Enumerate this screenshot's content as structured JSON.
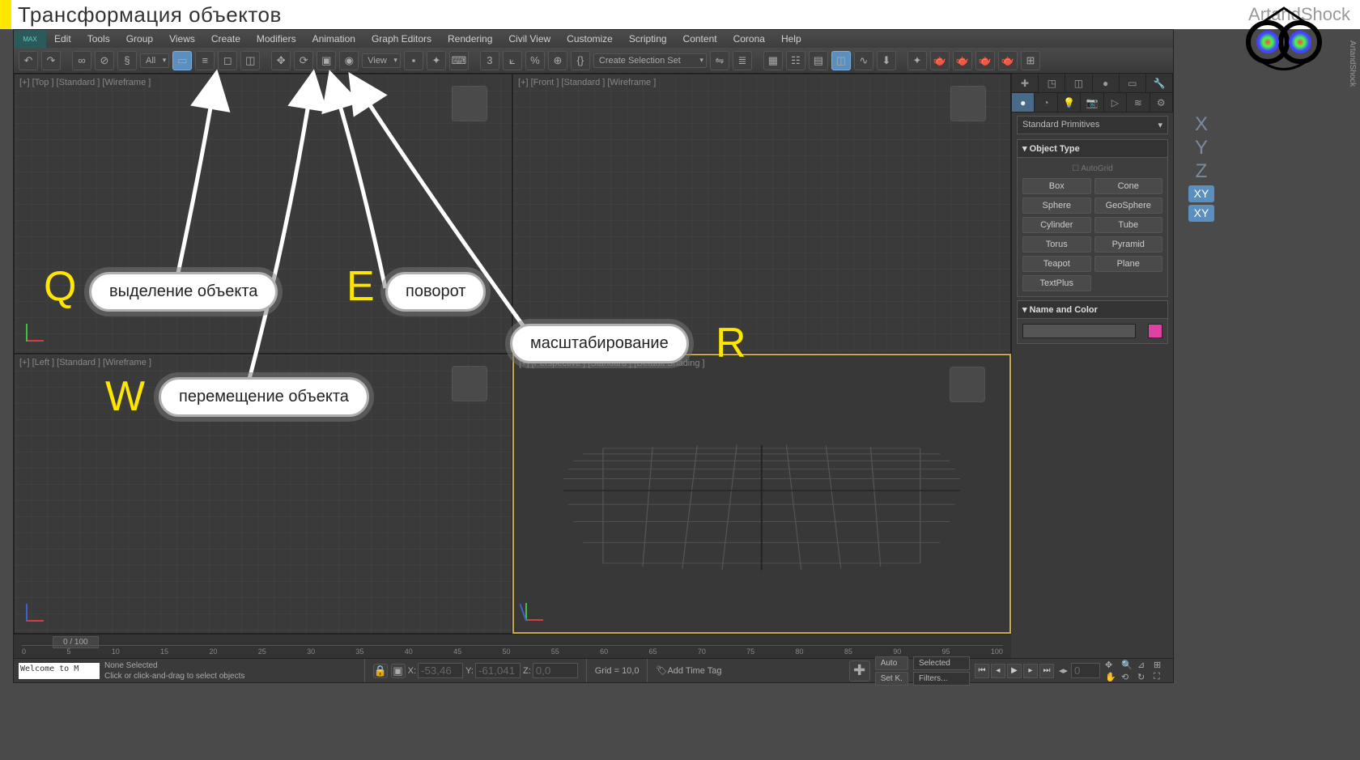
{
  "page_title": "Трансформация объектов",
  "brand": "ArtandShock",
  "menus": [
    "Edit",
    "Tools",
    "Group",
    "Views",
    "Create",
    "Modifiers",
    "Animation",
    "Graph Editors",
    "Rendering",
    "Civil View",
    "Customize",
    "Scripting",
    "Content",
    "Corona",
    "Help"
  ],
  "toolbar": {
    "filter_dd": "All",
    "ref_dd": "View",
    "selection_set_dd": "Create Selection Set"
  },
  "viewports": {
    "top": "[+] [Top ] [Standard ] [Wireframe ]",
    "front": "[+] [Front ] [Standard ] [Wireframe ]",
    "left": "[+] [Left ] [Standard ] [Wireframe ]",
    "persp": "[+] [Perspective ] [Standard ] [Default Shading ]"
  },
  "command_panel": {
    "dropdown": "Standard Primitives",
    "object_type_header": "Object Type",
    "autogrid": "AutoGrid",
    "primitives": [
      "Box",
      "Cone",
      "Sphere",
      "GeoSphere",
      "Cylinder",
      "Tube",
      "Torus",
      "Pyramid",
      "Teapot",
      "Plane",
      "TextPlus"
    ],
    "name_color_header": "Name and Color"
  },
  "timeline": {
    "slider": "0 / 100",
    "ticks": [
      "0",
      "5",
      "10",
      "15",
      "20",
      "25",
      "30",
      "35",
      "40",
      "45",
      "50",
      "55",
      "60",
      "65",
      "70",
      "75",
      "80",
      "85",
      "90",
      "95",
      "100"
    ]
  },
  "status": {
    "script": "Welcome to M",
    "selection": "None Selected",
    "hint": "Click or click-and-drag to select objects",
    "x_label": "X:",
    "x_val": "-53,46",
    "y_label": "Y:",
    "y_val": "-61,041",
    "z_label": "Z:",
    "z_val": "0,0",
    "grid": "Grid = 10,0",
    "add_tag": "Add Time Tag",
    "auto": "Auto",
    "setk": "Set K.",
    "selected_dd": "Selected",
    "filters": "Filters...",
    "frame": "0"
  },
  "annotations": {
    "q_key": "Q",
    "q_text": "выделение объекта",
    "w_key": "W",
    "w_text": "перемещение объекта",
    "e_key": "E",
    "e_text": "поворот",
    "r_key": "R",
    "r_text": "масштабирование"
  },
  "xyz": {
    "x": "X",
    "y": "Y",
    "z": "Z",
    "xy": "XY"
  }
}
